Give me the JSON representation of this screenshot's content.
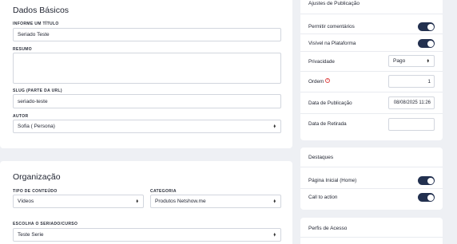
{
  "basics": {
    "title": "Dados Básicos",
    "title_field": {
      "label": "INFORME UM TÍTULO",
      "value": "Seriado Teste"
    },
    "summary_field": {
      "label": "RESUMO",
      "value": ""
    },
    "slug_field": {
      "label": "SLUG (PARTE DA URL)",
      "value": "seriado-teste"
    },
    "author_field": {
      "label": "AUTOR",
      "value": "Sofia ( Persona)"
    }
  },
  "organization": {
    "title": "Organização",
    "content_type": {
      "label": "TIPO DE CONTEÚDO",
      "value": "Vídeos"
    },
    "category": {
      "label": "CATEGORIA",
      "value": "Produtos Netshow.me"
    },
    "series": {
      "label": "ESCOLHA O SERIADO/CURSO",
      "value": "Teste Serie"
    }
  },
  "publication": {
    "title": "Ajustes de Publicação",
    "allow_comments": {
      "label": "Permitir comentários",
      "on": true
    },
    "visible": {
      "label": "Visível na Plataforma",
      "on": true
    },
    "privacy": {
      "label": "Privacidade",
      "value": "Pago"
    },
    "order": {
      "label": "Ordem",
      "value": "1",
      "help": "?"
    },
    "publish_date": {
      "label": "Data de Publicação",
      "value": "08/08/2025 11:26"
    },
    "remove_date": {
      "label": "Data de Retirada",
      "value": ""
    }
  },
  "highlights": {
    "title": "Destaques",
    "home": {
      "label": "Página Inicial (Home)",
      "on": true
    },
    "cta": {
      "label": "Call to action",
      "on": true
    }
  },
  "access": {
    "title": "Perfis de Acesso"
  },
  "colors": {
    "background": "#eef0f4",
    "card": "#ffffff",
    "toggle_on": "#22304f",
    "help_icon": "#e04848"
  }
}
